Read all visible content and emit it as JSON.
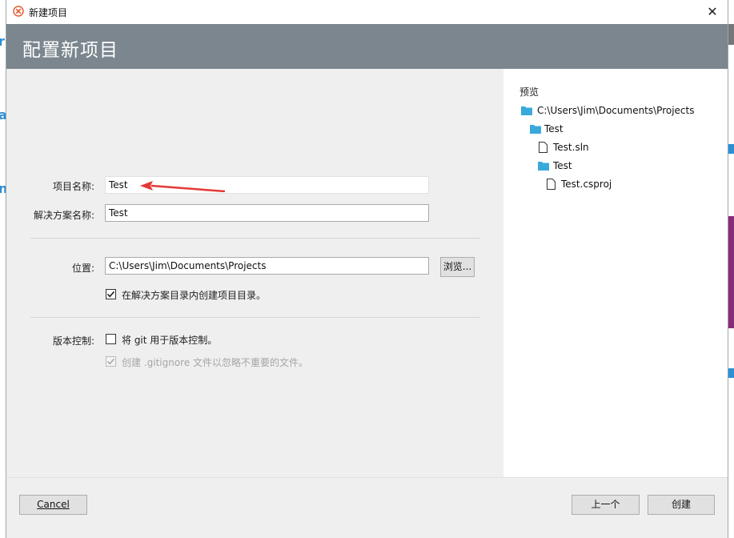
{
  "window": {
    "title": "新建项目",
    "close_glyph": "✕"
  },
  "header": {
    "title": "配置新项目"
  },
  "form": {
    "project_name_label": "项目名称:",
    "project_name_value": "Test",
    "solution_name_label": "解决方案名称:",
    "solution_name_value": "Test",
    "location_label": "位置:",
    "location_value": "C:\\Users\\Jim\\Documents\\Projects",
    "browse_label": "浏览...",
    "create_dir_label": "在解决方案目录内创建项目目录。",
    "create_dir_checked": true,
    "vcs_label": "版本控制:",
    "use_git_label": "将 git 用于版本控制。",
    "use_git_checked": false,
    "gitignore_label": "创建 .gitignore 文件以忽略不重要的文件。",
    "gitignore_checked": true,
    "gitignore_enabled": false
  },
  "preview": {
    "title": "预览",
    "tree": [
      {
        "label": "C:\\Users\\Jim\\Documents\\Projects",
        "icon": "folder-icon",
        "depth": 0
      },
      {
        "label": "Test",
        "icon": "folder-icon",
        "depth": 1
      },
      {
        "label": "Test.sln",
        "icon": "file-icon",
        "depth": 2
      },
      {
        "label": "Test",
        "icon": "folder-icon",
        "depth": 2
      },
      {
        "label": "Test.csproj",
        "icon": "file-icon",
        "depth": 3
      }
    ]
  },
  "footer": {
    "cancel_label": "Cancel",
    "back_label": "上一个",
    "create_label": "创建"
  },
  "colors": {
    "header_bg": "#7b868e",
    "folder": "#39a9dc",
    "annotation_arrow": "#e53935"
  }
}
